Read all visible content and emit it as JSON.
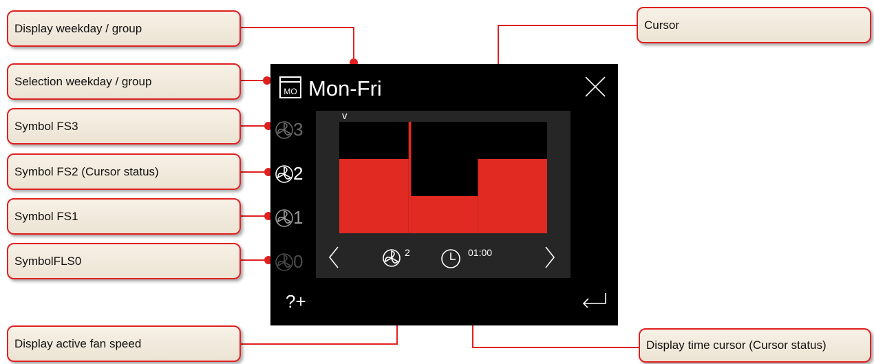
{
  "screen": {
    "title": "Mon-Fri",
    "weekday_icon_text": "MO",
    "cursor_mark": "v",
    "fan_levels": [
      {
        "label": "3"
      },
      {
        "label": "2"
      },
      {
        "label": "1"
      },
      {
        "label": "0"
      }
    ],
    "active_fan_speed": "2",
    "cursor_time": "01:00",
    "help_label": "?+"
  },
  "callouts": {
    "display_weekday": "Display weekday  / group",
    "selection_weekday": "Selection weekday / group",
    "symbol_fs3": "Symbol FS3",
    "symbol_fs2": "Symbol FS2 (Cursor status)",
    "symbol_fs1": "Symbol FS1",
    "symbol_fls0": "SymbolFLS0",
    "cursor": "Cursor",
    "active_fan_speed": "Display active fan speed",
    "time_cursor": "Display time cursor (Cursor status)"
  },
  "colors": {
    "accent": "#e02020",
    "chart_fill": "#e02a22",
    "screen_bg": "#000000",
    "panel_bg": "#262626",
    "callout_bg": "#f3ece0"
  },
  "chart_data": {
    "type": "area",
    "x_unit": "hours",
    "xlim": [
      0,
      24
    ],
    "ylim": [
      0,
      3
    ],
    "steps": [
      {
        "from": 0,
        "to": 8,
        "level": 2
      },
      {
        "from": 8,
        "to": 8.3,
        "level": 3
      },
      {
        "from": 8.3,
        "to": 16,
        "level": 1
      },
      {
        "from": 16,
        "to": 24,
        "level": 2
      }
    ],
    "cursor_hour": 1,
    "active_level": 2
  }
}
